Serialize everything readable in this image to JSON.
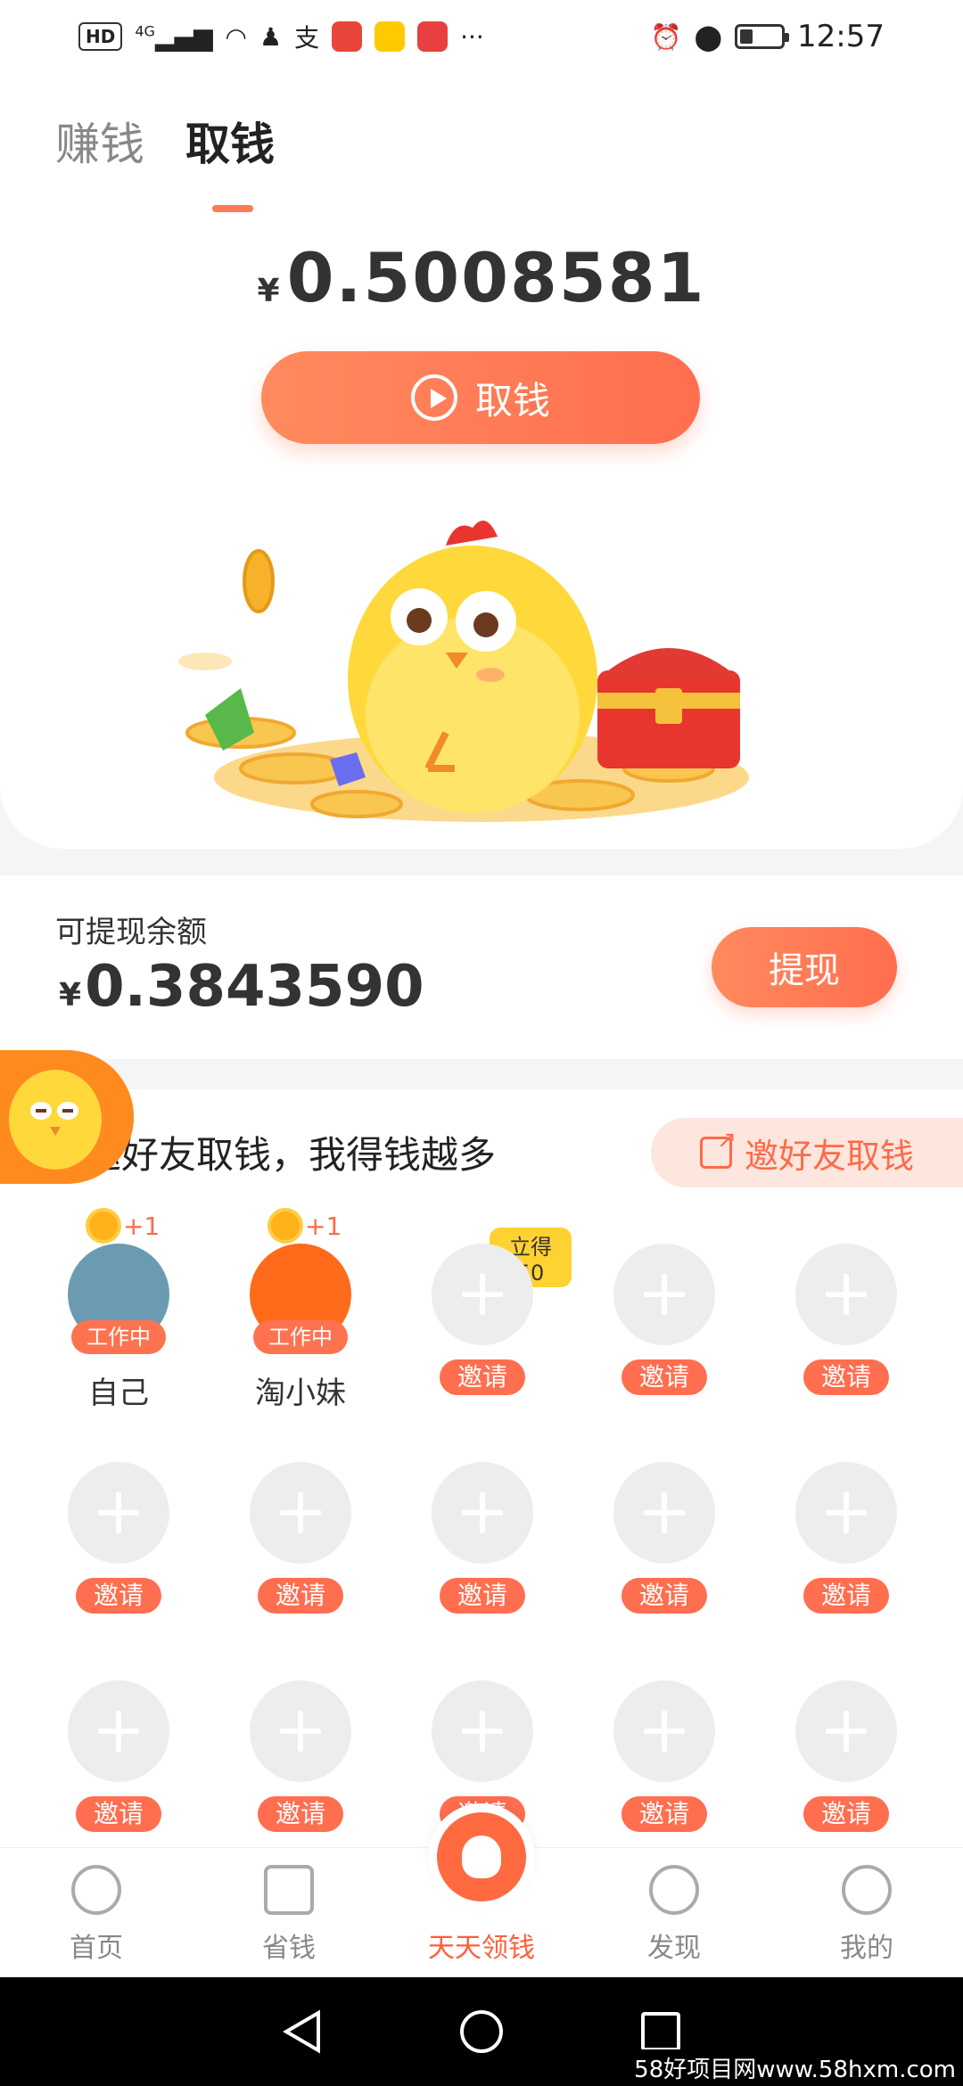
{
  "status_bar": {
    "hd": "HD",
    "network": "4G",
    "time": "12:57"
  },
  "tabs": [
    {
      "label": "赚钱",
      "active": false
    },
    {
      "label": "取钱",
      "active": true
    }
  ],
  "hero": {
    "currency": "¥",
    "amount": "0.5008581",
    "cta_label": "取钱"
  },
  "balance": {
    "label": "可提现余额",
    "currency": "¥",
    "amount": "0.3843590",
    "withdraw_label": "提现"
  },
  "invite": {
    "title": "邀好友取钱，我得钱越多",
    "button_label": "邀好友取钱",
    "members": [
      {
        "name": "自己",
        "status": "工作中",
        "plus": "+1"
      },
      {
        "name": "淘小妹",
        "status": "工作中",
        "plus": "+1"
      }
    ],
    "bonus_badge": "立得50",
    "invite_label": "邀请"
  },
  "bottom_nav": [
    {
      "label": "首页",
      "icon": "home-icon",
      "active": false
    },
    {
      "label": "省钱",
      "icon": "bag-icon",
      "active": false
    },
    {
      "label": "天天领钱",
      "icon": "money-bag-icon",
      "active": true
    },
    {
      "label": "发现",
      "icon": "compass-icon",
      "active": false
    },
    {
      "label": "我的",
      "icon": "profile-icon",
      "active": false
    }
  ],
  "watermark": "58好项目网www.58hxm.com",
  "colors": {
    "accent": "#ff6e4f",
    "accent_light": "#fde6de",
    "badge_yellow": "#ffd233"
  }
}
